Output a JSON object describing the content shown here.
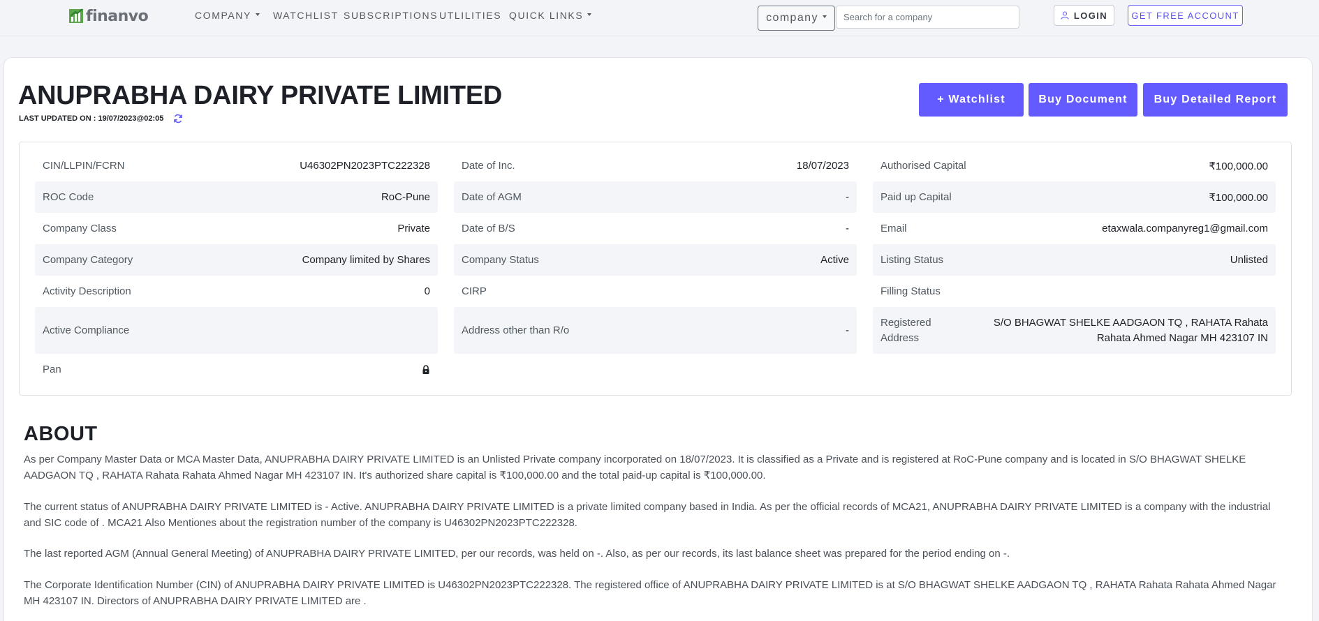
{
  "nav": {
    "logo_text": "finanvo",
    "items": [
      "COMPANY",
      "WATCHLIST",
      "SUBSCRIPTIONS",
      "UTLILITIES",
      "QUICK LINKS"
    ],
    "select_value": "company",
    "search_placeholder": "Search for a company",
    "login_label": "LOGIN",
    "free_account_label": "GET FREE ACCOUNT"
  },
  "company": {
    "name": "ANUPRABHA DAIRY PRIVATE LIMITED",
    "last_updated": "LAST UPDATED ON : 19/07/2023@02:05"
  },
  "actions": {
    "watchlist": "+ Watchlist",
    "buy_document": "Buy Document",
    "buy_report": "Buy Detailed Report"
  },
  "details": {
    "col1": [
      {
        "label": "CIN/LLPIN/FCRN",
        "value": "U46302PN2023PTC222328"
      },
      {
        "label": "ROC Code",
        "value": "RoC-Pune"
      },
      {
        "label": "Company Class",
        "value": "Private"
      },
      {
        "label": "Company Category",
        "value": "Company limited by Shares"
      },
      {
        "label": "Activity Description",
        "value": "0"
      },
      {
        "label": "Active Compliance",
        "value": ""
      },
      {
        "label": "Pan",
        "value": ""
      }
    ],
    "col2": [
      {
        "label": "Date of Inc.",
        "value": "18/07/2023"
      },
      {
        "label": "Date of AGM",
        "value": "-"
      },
      {
        "label": "Date of B/S",
        "value": "-"
      },
      {
        "label": "Company Status",
        "value": "Active"
      },
      {
        "label": "CIRP",
        "value": ""
      },
      {
        "label": "Address other than R/o",
        "value": "-"
      }
    ],
    "col3": [
      {
        "label": "Authorised Capital",
        "value": "₹100,000.00"
      },
      {
        "label": "Paid up Capital",
        "value": "₹100,000.00"
      },
      {
        "label": "Email",
        "value": "etaxwala.companyreg1@gmail.com"
      },
      {
        "label": "Listing Status",
        "value": "Unlisted"
      },
      {
        "label": "Filling Status",
        "value": ""
      },
      {
        "label": "Registered Address",
        "value": "S/O BHAGWAT SHELKE AADGAON TQ , RAHATA Rahata Rahata Ahmed Nagar MH 423107 IN"
      }
    ]
  },
  "about": {
    "title": "ABOUT",
    "paragraphs": [
      "As per Company Master Data or MCA Master Data, ANUPRABHA DAIRY PRIVATE LIMITED is an Unlisted Private company incorporated on 18/07/2023. It is classified as a Private and is registered at RoC-Pune company and is located in S/O BHAGWAT SHELKE AADGAON TQ , RAHATA Rahata Rahata Ahmed Nagar MH 423107 IN. It's authorized share capital is ₹100,000.00 and the total paid-up capital is ₹100,000.00.",
      "The current status of ANUPRABHA DAIRY PRIVATE LIMITED is - Active. ANUPRABHA DAIRY PRIVATE LIMITED is a private limited company based in India. As per the official records of MCA21, ANUPRABHA DAIRY PRIVATE LIMITED is a company with the industrial and SIC code of . MCA21 Also Mentiones about the registration number of the company is U46302PN2023PTC222328.",
      "The last reported AGM (Annual General Meeting) of ANUPRABHA DAIRY PRIVATE LIMITED, per our records, was held on -. Also, as per our records, its last balance sheet was prepared for the period ending on -.",
      "The Corporate Identification Number (CIN) of ANUPRABHA DAIRY PRIVATE LIMITED is U46302PN2023PTC222328. The registered office of ANUPRABHA DAIRY PRIVATE LIMITED is at S/O BHAGWAT SHELKE AADGAON TQ , RAHATA Rahata Rahata Ahmed Nagar MH 423107 IN. Directors of ANUPRABHA DAIRY PRIVATE LIMITED are ."
    ]
  },
  "colors": {
    "accent": "#635bff",
    "logo_green": "#4caf50"
  }
}
